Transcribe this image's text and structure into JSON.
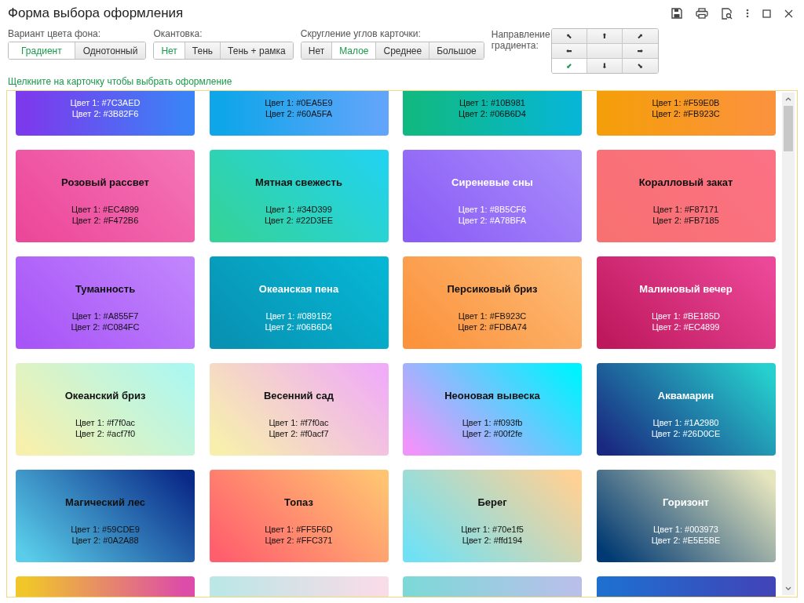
{
  "window": {
    "title": "Форма выбора оформления"
  },
  "options": [
    {
      "label": "Вариант цвета фона:",
      "buttons": [
        {
          "label": "Градиент",
          "selected": true
        },
        {
          "label": "Однотонный",
          "selected": false
        }
      ]
    },
    {
      "label": "Окантовка:",
      "buttons": [
        {
          "label": "Нет",
          "selected": true
        },
        {
          "label": "Тень",
          "selected": false
        },
        {
          "label": "Тень + рамка",
          "selected": false
        }
      ]
    },
    {
      "label": "Скругление углов карточки:",
      "buttons": [
        {
          "label": "Нет",
          "selected": false
        },
        {
          "label": "Малое",
          "selected": true
        },
        {
          "label": "Среднее",
          "selected": false
        },
        {
          "label": "Большое",
          "selected": false
        }
      ]
    }
  ],
  "direction": {
    "label": "Направление градиента:",
    "buttons": [
      {
        "label": "⬉",
        "selected": false
      },
      {
        "label": "⬆",
        "selected": false
      },
      {
        "label": "⬈",
        "selected": false
      },
      {
        "label": "⬅",
        "selected": false
      },
      {
        "label": "➡",
        "selected": false
      },
      {
        "label": "⬋",
        "selected": true
      },
      {
        "label": "⬇",
        "selected": false
      },
      {
        "label": "⬊",
        "selected": false
      }
    ]
  },
  "hint": "Щелкните на карточку чтобы выбрать оформление",
  "cards": [
    {
      "kind": "light",
      "gradient": [
        {
          "color": "#7c3aed"
        },
        {
          "color": "#3b82f6"
        }
      ],
      "lines": [
        "Цвет 1: #7C3AED",
        "Цвет 2: #3B82F6"
      ]
    },
    {
      "kind": "dark",
      "gradient": [
        {
          "color": "#0ea5e9"
        },
        {
          "color": "#60a5fa"
        }
      ],
      "lines": [
        "Цвет 1: #0EA5E9",
        "Цвет 2: #60A5FA"
      ]
    },
    {
      "kind": "dark",
      "gradient": [
        {
          "color": "#10b981"
        },
        {
          "color": "#06b6d4"
        }
      ],
      "lines": [
        "Цвет 1: #10B981",
        "Цвет 2: #06B6D4"
      ]
    },
    {
      "kind": "dark",
      "gradient": [
        {
          "color": "#f59e0b"
        },
        {
          "color": "#fb923c"
        }
      ],
      "lines": [
        "Цвет 1: #F59E0B",
        "Цвет 2: #FB923C"
      ]
    },
    {
      "name": "Розовый рассвет",
      "kind": "dark",
      "gradient": [
        {
          "color": "#ec4899"
        },
        {
          "color": "#f472b6"
        }
      ],
      "lines": [
        "Цвет 1: #EC4899",
        "Цвет 2: #F472B6"
      ]
    },
    {
      "name": "Мятная свежесть",
      "kind": "dark",
      "gradient": [
        {
          "color": "#34d399"
        },
        {
          "color": "#22d3ee"
        }
      ],
      "lines": [
        "Цвет 1: #34D399",
        "Цвет 2: #22D3EE"
      ]
    },
    {
      "name": "Сиреневые сны",
      "kind": "light",
      "gradient": [
        {
          "color": "#8b5cf6"
        },
        {
          "color": "#a78bfa"
        }
      ],
      "lines": [
        "Цвет 1: #8B5CF6",
        "Цвет 2: #A78BFA"
      ]
    },
    {
      "name": "Коралловый закат",
      "kind": "dark",
      "gradient": [
        {
          "color": "#f87171"
        },
        {
          "color": "#fb7185"
        }
      ],
      "lines": [
        "Цвет 1: #F87171",
        "Цвет 2: #FB7185"
      ]
    },
    {
      "name": "Туманность",
      "kind": "dark",
      "gradient": [
        {
          "color": "#a855f7"
        },
        {
          "color": "#c084fc"
        }
      ],
      "lines": [
        "Цвет 1: #A855F7",
        "Цвет 2: #C084FC"
      ]
    },
    {
      "name": "Океанская пена",
      "kind": "light",
      "gradient": [
        {
          "color": "#0891b2"
        },
        {
          "color": "#06b6d4"
        }
      ],
      "lines": [
        "Цвет 1: #0891B2",
        "Цвет 2: #06B6D4"
      ]
    },
    {
      "name": "Персиковый бриз",
      "kind": "dark",
      "gradient": [
        {
          "color": "#fb923c"
        },
        {
          "color": "#fdba74"
        }
      ],
      "lines": [
        "Цвет 1: #FB923C",
        "Цвет 2: #FDBA74"
      ]
    },
    {
      "name": "Малиновый вечер",
      "kind": "light",
      "gradient": [
        {
          "color": "#be185d"
        },
        {
          "color": "#ec4899"
        }
      ],
      "lines": [
        "Цвет 1: #BE185D",
        "Цвет 2: #EC4899"
      ]
    },
    {
      "name": "Океанский бриз",
      "kind": "dark",
      "gradient": [
        {
          "color": "#f7f0ac"
        },
        {
          "color": "#acf7f0"
        }
      ],
      "lines": [
        "Цвет 1: #f7f0ac",
        "Цвет 2: #acf7f0"
      ]
    },
    {
      "name": "Весенний сад",
      "kind": "dark",
      "gradient": [
        {
          "color": "#f7f0ac"
        },
        {
          "color": "#f0acf7"
        }
      ],
      "lines": [
        "Цвет 1: #f7f0ac",
        "Цвет 2: #f0acf7"
      ]
    },
    {
      "name": "Неоновая вывеска",
      "kind": "dark",
      "gradient": [
        {
          "color": "#f093fb"
        },
        {
          "color": "#00f2fe"
        }
      ],
      "lines": [
        "Цвет 1: #f093fb",
        "Цвет 2: #00f2fe"
      ]
    },
    {
      "name": "Аквамарин",
      "kind": "light",
      "gradient": [
        {
          "color": "#1a2980"
        },
        {
          "color": "#26d0ce"
        }
      ],
      "lines": [
        "Цвет 1: #1A2980",
        "Цвет 2: #26D0CE"
      ]
    },
    {
      "name": "Магический лес",
      "kind": "dark",
      "gradient": [
        {
          "color": "#59cde9"
        },
        {
          "color": "#0a2a88"
        }
      ],
      "lines": [
        "Цвет 1: #59CDE9",
        "Цвет 2: #0A2A88"
      ]
    },
    {
      "name": "Топаз",
      "kind": "dark",
      "gradient": [
        {
          "color": "#ff5f6d"
        },
        {
          "color": "#ffc371"
        }
      ],
      "lines": [
        "Цвет 1: #FF5F6D",
        "Цвет 2: #FFC371"
      ]
    },
    {
      "name": "Берег",
      "kind": "dark",
      "gradient": [
        {
          "color": "#70e1f5"
        },
        {
          "color": "#ffd194"
        }
      ],
      "lines": [
        "Цвет 1: #70e1f5",
        "Цвет 2: #ffd194"
      ]
    },
    {
      "name": "Горизонт",
      "kind": "light",
      "gradient": [
        {
          "color": "#003973"
        },
        {
          "color": "#e5e5be"
        }
      ],
      "lines": [
        "Цвет 1: #003973",
        "Цвет 2: #E5E5BE"
      ]
    },
    {
      "gradient": [
        {
          "color": "#f0c62a"
        },
        {
          "color": "#dd4ca8"
        }
      ]
    },
    {
      "gradient": [
        {
          "color": "#bde6e6"
        },
        {
          "color": "#f8dce8"
        }
      ]
    },
    {
      "gradient": [
        {
          "color": "#7fd8d8"
        },
        {
          "color": "#b8c0ea"
        }
      ]
    },
    {
      "gradient": [
        {
          "color": "#1e6fd0"
        },
        {
          "color": "#4045b8"
        }
      ]
    }
  ]
}
